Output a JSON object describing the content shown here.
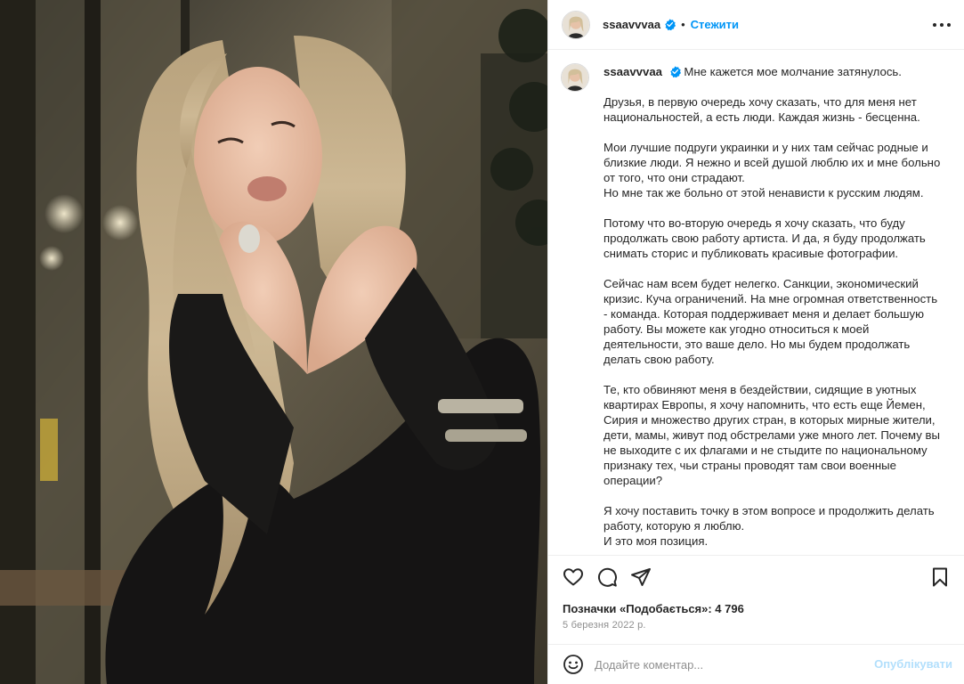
{
  "post": {
    "username": "ssaavvvaa",
    "follow_label": "Стежити",
    "separator": "•",
    "more_icon": "more-horizontal-icon"
  },
  "caption": {
    "username": "ssaavvvaa",
    "first_line": "Мне кажется мое молчание затянулось.",
    "paragraphs": [
      "Друзья, в первую очередь хочу сказать, что для меня нет национальностей, а есть люди. Каждая жизнь - бесценна.",
      "Мои лучшие подруги украинки и у них там сейчас родные и близкие люди. Я нежно и всей душой люблю их и мне больно от того, что они страдают.\nНо мне так же больно от этой ненависти к русским людям.",
      "Потому что во-вторую очередь я хочу сказать, что буду продолжать свою работу артиста. И да, я буду продолжать снимать сторис и публиковать красивые фотографии.",
      "Сейчас нам всем будет нелегко. Санкции, экономический кризис. Куча ограничений. На мне огромная ответственность - команда. Которая поддерживает меня и делает большую работу. Вы можете как угодно относиться к моей деятельности, это ваше дело. Но мы будем продолжать делать свою работу.",
      "Те, кто обвиняют меня в бездействии, сидящие в уютных квартирах Европы, я хочу напомнить, что есть еще Йемен, Сирия и множество других стран, в которых мирные жители, дети, мамы, живут под обстрелами уже много лет. Почему вы не выходите с их флагами и не стыдите по национальному признаку тех, чьи страны проводят там свои военные операции?",
      "Я хочу поставить точку в этом вопросе и продолжить делать работу, которую я люблю.\nИ это моя позиция."
    ]
  },
  "actions": {
    "icons": [
      "heart-icon",
      "comment-icon",
      "share-icon",
      "bookmark-icon"
    ]
  },
  "likes": {
    "text": "Позначки «Подобається»: 4 796"
  },
  "date": "5 березня 2022 р.",
  "comment": {
    "placeholder": "Додайте коментар...",
    "publish_label": "Опублікувати",
    "emoji_icon": "emoji-icon"
  },
  "colors": {
    "accent": "#0095f6",
    "publish_disabled": "#b2dffc",
    "text": "#262626",
    "muted": "#8e8e8e",
    "border": "#efefef"
  }
}
